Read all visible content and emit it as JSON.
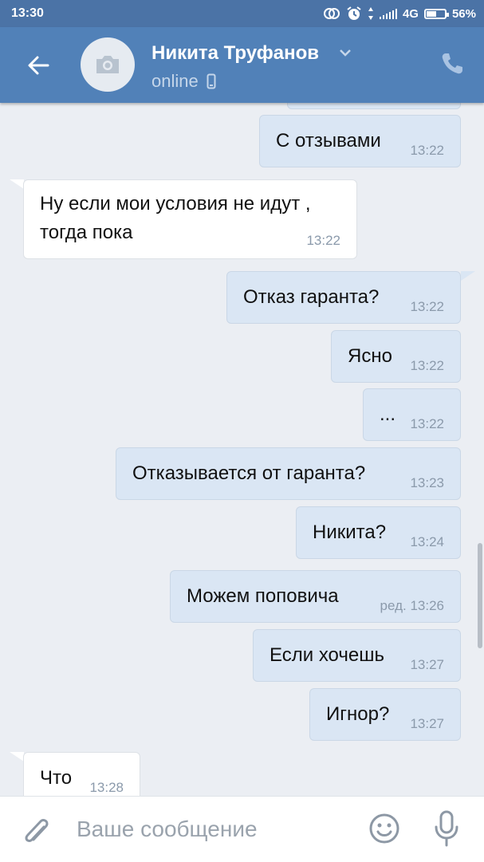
{
  "status_bar": {
    "time": "13:30",
    "network": "4G",
    "battery": "56%",
    "battery_level": 0.56
  },
  "header": {
    "contact_name": "Никита Труфанов",
    "status": "online",
    "icons": [
      "back-arrow-icon",
      "camera-icon",
      "chevron-down-icon",
      "mobile-icon",
      "phone-icon"
    ]
  },
  "messages": [
    {
      "dir": "out",
      "text": "С отзывами",
      "time": "13:22"
    },
    {
      "dir": "in",
      "text_lines": [
        "Ну если мои условия не идут ,",
        "тогда пока"
      ],
      "time": "13:22"
    },
    {
      "dir": "out",
      "text": "Отказ гаранта?",
      "time": "13:22"
    },
    {
      "dir": "out",
      "text": "Ясно",
      "time": "13:22"
    },
    {
      "dir": "out",
      "text": "...",
      "time": "13:22"
    },
    {
      "dir": "out",
      "text": "Отказывается от гаранта?",
      "time": "13:23"
    },
    {
      "dir": "out",
      "text": "Никита?",
      "time": "13:24"
    },
    {
      "dir": "out",
      "text": "Можем поповича",
      "time": "ред. 13:26"
    },
    {
      "dir": "out",
      "text": "Если хочешь",
      "time": "13:27"
    },
    {
      "dir": "out",
      "text": "Игнор?",
      "time": "13:27"
    },
    {
      "dir": "in",
      "text": "Что",
      "time": "13:28"
    }
  ],
  "composer": {
    "placeholder": "Ваше сообщение",
    "icons": [
      "attach-icon",
      "emoji-icon",
      "microphone-icon"
    ]
  },
  "colors": {
    "header": "#5181b8",
    "status_bar": "#4b73a6",
    "background": "#ebeef3",
    "outgoing_bubble": "#dae6f4",
    "incoming_bubble": "#ffffff",
    "timestamp": "#8b9aab"
  }
}
